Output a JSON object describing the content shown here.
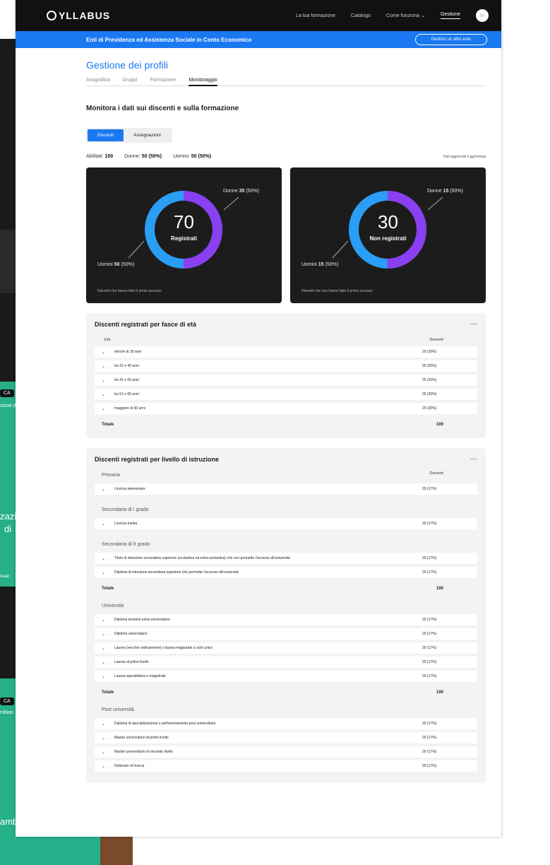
{
  "header": {
    "logo": "YLLABUS",
    "nav": [
      "La tua formazione",
      "Catalogo",
      "Come funziona",
      "Gestione"
    ],
    "avatar": "MI"
  },
  "ente": {
    "name": "Enti di Previdenza ed Assistenza Sociale in Conto Economico",
    "switch_label": "Gestisci un altro ente"
  },
  "page": {
    "title": "Gestione dei profili",
    "tabs": [
      "Anagrafica",
      "Gruppi",
      "Formazione",
      "Monitoraggio"
    ],
    "section_title": "Monitora i dati sui discenti e sulla formazione",
    "segments": [
      "Discenti",
      "Assegnazioni"
    ]
  },
  "stats": {
    "abilitati_label": "Abilitati:",
    "abilitati_value": "100",
    "donne_label": "Donne:",
    "donne_value": "50 (50%)",
    "uomini_label": "Uomini:",
    "uomini_value": "50 (50%)",
    "updated": "Dati aggiornati a gg/mm/aa"
  },
  "cards": [
    {
      "value": "70",
      "label": "Registrati",
      "women_label": "Donne",
      "women_value": "35",
      "women_pct": "(50%)",
      "men_label": "Uomini",
      "men_value": "50",
      "men_pct": "(50%)",
      "description": "Discenti che hanno fatto il primo accesso",
      "women_share": 0.5,
      "color_women": "#8a3ff0",
      "color_men": "#2a9df4"
    },
    {
      "value": "30",
      "label": "Non registrati",
      "women_label": "Donne",
      "women_value": "15",
      "women_pct": "(50%)",
      "men_label": "Uomini",
      "men_value": "15",
      "men_pct": "(50%)",
      "description": "Discenti che non hanno fatto il primo accesso",
      "women_share": 0.5,
      "color_women": "#8a3ff0",
      "color_men": "#2a9df4"
    }
  ],
  "age_panel": {
    "title": "Discenti registrati per fasce di età",
    "col_left": "Età",
    "col_right": "Discenti",
    "rows": [
      {
        "label": "minore di 30 anni",
        "value": "20 (20%)"
      },
      {
        "label": "tra 31 e 40 anni",
        "value": "20 (20%)"
      },
      {
        "label": "tra 41 e 50 anni",
        "value": "20 (20%)"
      },
      {
        "label": "tra 51 e 60 anni",
        "value": "20 (20%)"
      },
      {
        "label": "maggiore di 60 anni",
        "value": "20 (20%)"
      }
    ],
    "total_label": "Totale",
    "total_value": "100"
  },
  "edu_panel": {
    "title": "Discenti registrati per livello di istruzione",
    "col_right": "Discenti",
    "total_label": "Totale",
    "groups": [
      {
        "name": "Primaria",
        "rows": [
          {
            "label": "Licenza elementare",
            "value": "20 (17%)"
          }
        ]
      },
      {
        "name": "Secondaria di I grado",
        "rows": [
          {
            "label": "Licenza media",
            "value": "20 (17%)"
          }
        ]
      },
      {
        "name": "Secondaria di II grado",
        "rows": [
          {
            "label": "Titolo di istruzione secondaria superiore (scolastica ed extra-scolastica) che non permette l'accesso all'università",
            "value": "20 (17%)"
          },
          {
            "label": "Diploma di istruzione secondaria superiore che permette l'accesso all'università",
            "value": "20 (17%)"
          }
        ],
        "total": "100"
      },
      {
        "name": "Università",
        "rows": [
          {
            "label": "Diploma terziario extra-universitario",
            "value": "20 (17%)"
          },
          {
            "label": "Diploma universitario",
            "value": "20 (17%)"
          },
          {
            "label": "Laurea (vecchio ordinamento) o laurea magistrale a ciclo unico",
            "value": "20 (17%)"
          },
          {
            "label": "Laurea di primo livello",
            "value": "20 (17%)"
          },
          {
            "label": "Laurea specialistica o magistrale",
            "value": "20 (17%)"
          }
        ],
        "total": "100"
      },
      {
        "name": "Post università",
        "rows": [
          {
            "label": "Diploma di specializzazione o perfezionamento post universitario",
            "value": "20 (17%)"
          },
          {
            "label": "Master universitario di primo livello",
            "value": "20 (17%)"
          },
          {
            "label": "Master universitario di secondo livello",
            "value": "20 (17%)"
          },
          {
            "label": "Dottorato di ricerca",
            "value": "20 (17%)"
          }
        ]
      }
    ]
  },
  "background": {
    "tag1": "CA",
    "tag2": "CA",
    "text1": "zazi",
    "text2": "di",
    "text3": "amb",
    "text4": "inuar",
    "text5": "zione d",
    "text6": "mbian"
  }
}
